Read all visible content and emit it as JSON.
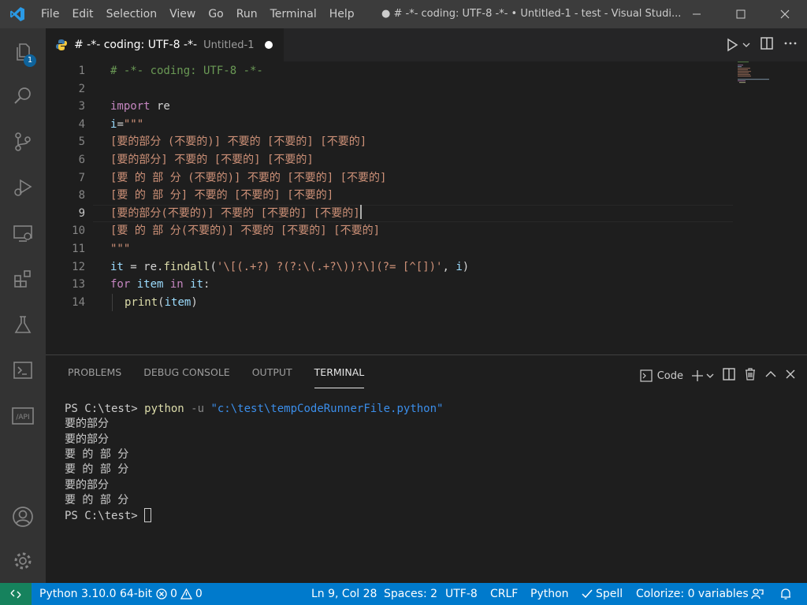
{
  "titlebar": {
    "menu": [
      "File",
      "Edit",
      "Selection",
      "View",
      "Go",
      "Run",
      "Terminal",
      "Help"
    ],
    "title": "● # -*- coding: UTF-8 -*- • Untitled-1 - test - Visual Studi..."
  },
  "activity": {
    "explorer_badge": "1"
  },
  "tab": {
    "title": "# -*- coding: UTF-8 -*-",
    "description": "Untitled-1"
  },
  "editor": {
    "line_numbers": [
      "1",
      "2",
      "3",
      "4",
      "5",
      "6",
      "7",
      "8",
      "9",
      "10",
      "11",
      "12",
      "13",
      "14"
    ],
    "active_line": "9",
    "code": {
      "l1": "# -*- coding: UTF-8 -*-",
      "l3_kw": "import",
      "l3_mod": " re",
      "l4_var": "i",
      "l4_eq": "=",
      "l4_str": "\"\"\"",
      "l5": "[要的部分 (不要的)] 不要的 [不要的] [不要的]",
      "l6": "[要的部分] 不要的 [不要的] [不要的]",
      "l7": "[要 的 部 分 (不要的)] 不要的 [不要的] [不要的]",
      "l8": "[要 的 部 分] 不要的 [不要的] [不要的]",
      "l9": "[要的部分(不要的)] 不要的 [不要的] [不要的]",
      "l10": "[要 的 部 分(不要的)] 不要的 [不要的] [不要的]",
      "l11": "\"\"\"",
      "l12_var": "it",
      "l12_op": " = ",
      "l12_mod": "re",
      "l12_dot": ".",
      "l12_fn": "findall",
      "l12_open": "(",
      "l12_str": "'\\[(.+?) ?(?:\\(.+?\\))?\\](?= [^[])'",
      "l12_comma": ", ",
      "l12_arg": "i",
      "l12_close": ")",
      "l13_kw1": "for",
      "l13_var1": " item ",
      "l13_kw2": "in",
      "l13_var2": " it",
      "l13_colon": ":",
      "l14_fn": "print",
      "l14_open": "(",
      "l14_var": "item",
      "l14_close": ")"
    }
  },
  "panel": {
    "tabs": [
      "PROBLEMS",
      "DEBUG CONSOLE",
      "OUTPUT",
      "TERMINAL"
    ],
    "active_tab": "TERMINAL",
    "terminal_name": "Code",
    "terminal": {
      "prompt": "PS C:\\test> ",
      "cmd": "python",
      "flag": " -u ",
      "path": "\"c:\\test\\tempCodeRunnerFile.python\"",
      "output": [
        "要的部分",
        "要的部分",
        "要 的 部 分",
        "要 的 部 分",
        "要的部分",
        "要 的 部 分"
      ],
      "prompt2": "PS C:\\test> "
    }
  },
  "statusbar": {
    "python": "Python 3.10.0 64-bit",
    "errors": "0",
    "warnings": "0",
    "position": "Ln 9, Col 28",
    "spaces": "Spaces: 2",
    "encoding": "UTF-8",
    "eol": "CRLF",
    "language": "Python",
    "spell": "Spell",
    "colorize": "Colorize: 0 variables"
  },
  "colors": {
    "statusbar": "#007acc",
    "remote": "#16825d",
    "activitybar": "#333333",
    "editor_bg": "#1e1e1e"
  },
  "icons": [
    "vscode-logo-icon",
    "explorer-icon",
    "search-icon",
    "source-control-icon",
    "run-debug-icon",
    "remote-explorer-icon",
    "extensions-icon",
    "testing-icon",
    "terminal-icon",
    "api-icon",
    "account-icon",
    "settings-gear-icon",
    "python-file-icon",
    "run-icon",
    "split-editor-icon",
    "more-icon",
    "terminal-profile-icon",
    "add-icon",
    "chevron-down-icon",
    "split-terminal-icon",
    "trash-icon",
    "chevron-up-icon",
    "close-icon",
    "remote-icon",
    "error-icon",
    "warning-icon",
    "check-icon",
    "feedback-icon",
    "bell-icon"
  ]
}
